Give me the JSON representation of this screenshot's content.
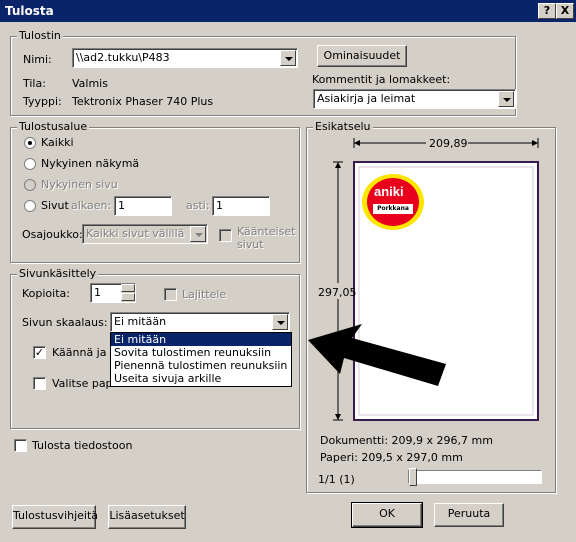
{
  "window": {
    "title": "Tulosta",
    "help_label": "?",
    "close_label": "X"
  },
  "printer": {
    "legend": "Tulostin",
    "name_label": "Nimi:",
    "name_value": "\\\\ad2.tukku\\P483",
    "status_label": "Tila:",
    "status_value": "Valmis",
    "type_label": "Tyyppi:",
    "type_value": "Tektronix Phaser 740 Plus",
    "properties_button": "Ominaisuudet",
    "comments_label": "Kommentit ja lomakkeet:",
    "comments_value": "Asiakirja ja leimat"
  },
  "print_range": {
    "legend": "Tulostusalue",
    "all": "Kaikki",
    "current_view": "Nykyinen näkymä",
    "current_page": "Nykyinen sivu",
    "pages": "Sivut",
    "from_label": "alkaen:",
    "from_value": "1",
    "to_label": "asti:",
    "to_value": "1",
    "subset_label": "Osajoukko:",
    "subset_value": "Kaikki sivut välillä",
    "reverse_label_1": "Käänteiset",
    "reverse_label_2": "sivut"
  },
  "page_handling": {
    "legend": "Sivunkäsittely",
    "copies_label": "Kopioita:",
    "copies_value": "1",
    "collate_label": "Lajittele",
    "scaling_label": "Sivun skaalaus:",
    "scaling_value": "Ei mitään",
    "scaling_options": [
      "Ei mitään",
      "Sovita tulostimen reunuksiin",
      "Pienennä tulostimen reunuksiin",
      "Useita sivuja arkille"
    ],
    "rotate_label": "Käännä ja ke",
    "rotate_checked": true,
    "choose_paper_label": "Valitse paperilähde PDF-sivukoon mukaan"
  },
  "print_to_file_label": "Tulosta tiedostoon",
  "preview": {
    "legend": "Esikatselu",
    "width_dim": "209,89",
    "height_dim": "297,05",
    "logo_text": "aniki",
    "logo_sub": "Porkkana",
    "document_size": "Dokumentti: 209,9 x 296,7 mm",
    "paper_size": "Paperi: 209,5 x 297,0 mm",
    "page_counter": "1/1 (1)"
  },
  "buttons": {
    "tips": "Tulostusvihjeitä",
    "advanced": "Lisäasetukset",
    "ok": "OK",
    "cancel": "Peruuta"
  },
  "colors": {
    "title_bar": "#0a246a",
    "logo_red": "#e8001c",
    "logo_yellow": "#ffe600"
  }
}
